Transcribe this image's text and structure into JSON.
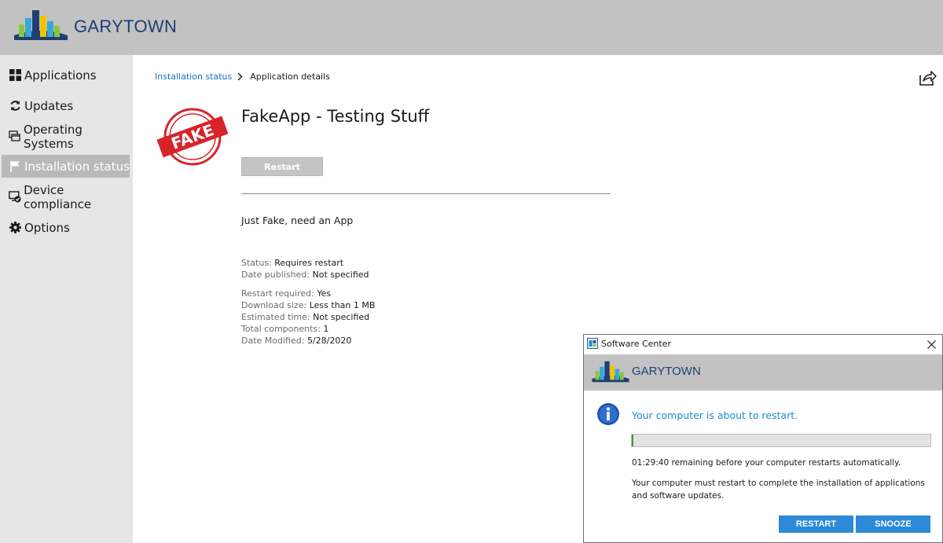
{
  "header": {
    "brand": "GARYTOWN"
  },
  "sidebar": {
    "items": [
      {
        "label": "Applications",
        "icon": "applications-grid-icon",
        "active": false
      },
      {
        "label": "Updates",
        "icon": "refresh-icon",
        "active": false
      },
      {
        "label": "Operating Systems",
        "icon": "windows-stack-icon",
        "active": false
      },
      {
        "label": "Installation status",
        "icon": "flag-icon",
        "active": true
      },
      {
        "label": "Device compliance",
        "icon": "device-check-icon",
        "active": false
      },
      {
        "label": "Options",
        "icon": "gear-icon",
        "active": false
      }
    ]
  },
  "breadcrumb": {
    "parent": "Installation status",
    "current": "Application details"
  },
  "app": {
    "logo_text": "FAKE",
    "title": "FakeApp - Testing Stuff",
    "action_label": "Restart",
    "description": "Just Fake, need an App",
    "details_group1": [
      {
        "label": "Status:",
        "value": "Requires restart"
      },
      {
        "label": "Date published:",
        "value": "Not specified"
      }
    ],
    "details_group2": [
      {
        "label": "Restart required:",
        "value": "Yes"
      },
      {
        "label": "Download size:",
        "value": "Less than 1 MB"
      },
      {
        "label": "Estimated time:",
        "value": "Not specified"
      },
      {
        "label": "Total components:",
        "value": "1"
      },
      {
        "label": "Date Modified:",
        "value": "5/28/2020"
      }
    ]
  },
  "dialog": {
    "title": "Software Center",
    "brand": "GARYTOWN",
    "message": "Your computer is about to restart.",
    "progress_percent": 0.5,
    "remaining": "01:29:40 remaining before your computer restarts automatically.",
    "body": "Your computer must restart to complete the installation of applications and software updates.",
    "restart_label": "RESTART",
    "snooze_label": "SNOOZE"
  },
  "colors": {
    "header_bg": "#c2c2c2",
    "sidebar_bg": "#e6e6e6",
    "active_nav_bg": "#b9b9b9",
    "brand_text": "#1f3f73",
    "link": "#1a6fc4",
    "accent_button": "#2c8ad8",
    "progress_fill": "#2fa52f",
    "fake_stamp": "#d8232a"
  }
}
